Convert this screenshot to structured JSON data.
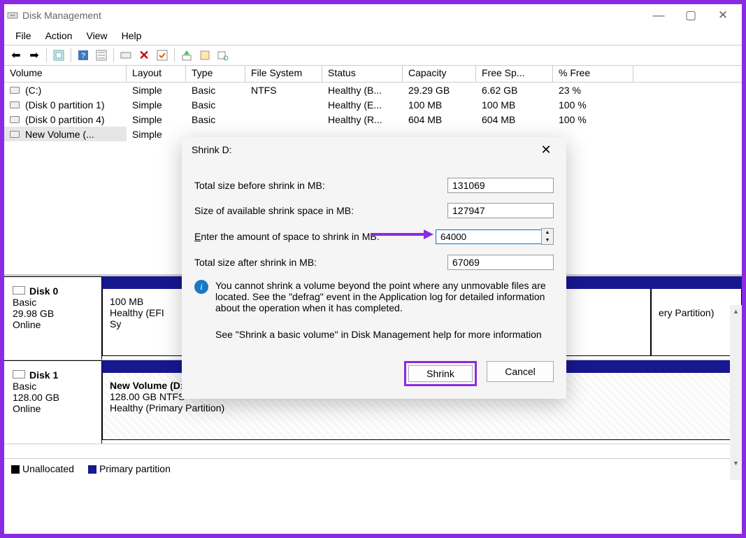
{
  "title": "Disk Management",
  "menu": {
    "file": "File",
    "action": "Action",
    "view": "View",
    "help": "Help"
  },
  "table": {
    "headers": {
      "vol": "Volume",
      "layout": "Layout",
      "type": "Type",
      "fs": "File System",
      "status": "Status",
      "cap": "Capacity",
      "free": "Free Sp...",
      "pct": "% Free"
    },
    "rows": [
      {
        "vol": "(C:)",
        "layout": "Simple",
        "type": "Basic",
        "fs": "NTFS",
        "status": "Healthy (B...",
        "cap": "29.29 GB",
        "free": "6.62 GB",
        "pct": "23 %"
      },
      {
        "vol": "(Disk 0 partition 1)",
        "layout": "Simple",
        "type": "Basic",
        "fs": "",
        "status": "Healthy (E...",
        "cap": "100 MB",
        "free": "100 MB",
        "pct": "100 %"
      },
      {
        "vol": "(Disk 0 partition 4)",
        "layout": "Simple",
        "type": "Basic",
        "fs": "",
        "status": "Healthy (R...",
        "cap": "604 MB",
        "free": "604 MB",
        "pct": "100 %"
      },
      {
        "vol": "New Volume (...",
        "layout": "Simple",
        "type": "",
        "fs": "",
        "status": "",
        "cap": "",
        "free": "",
        "pct": ""
      }
    ]
  },
  "disks": [
    {
      "name": "Disk 0",
      "type": "Basic",
      "size": "29.98 GB",
      "state": "Online",
      "parts": [
        {
          "title": "",
          "line1": "100 MB",
          "line2": "Healthy (EFI Sy"
        },
        {
          "title": "",
          "line1": "",
          "line2": ""
        },
        {
          "title": "",
          "line1": "",
          "line2": "ery Partition)"
        }
      ]
    },
    {
      "name": "Disk 1",
      "type": "Basic",
      "size": "128.00 GB",
      "state": "Online",
      "parts": [
        {
          "title": "New Volume  (D:)",
          "line1": "128.00 GB NTFS",
          "line2": "Healthy (Primary Partition)"
        }
      ]
    }
  ],
  "legend": {
    "unalloc": "Unallocated",
    "primary": "Primary partition"
  },
  "dialog": {
    "title": "Shrink D:",
    "l1": "Total size before shrink in MB:",
    "v1": "131069",
    "l2": "Size of available shrink space in MB:",
    "v2": "127947",
    "l3": "Enter the amount of space to shrink in MB:",
    "v3": "64000",
    "l4": "Total size after shrink in MB:",
    "v4": "67069",
    "info1": "You cannot shrink a volume beyond the point where any unmovable files are located. See the \"defrag\" event in the Application log for detailed information about the operation when it has completed.",
    "info2": "See \"Shrink a basic volume\" in Disk Management help for more information",
    "btn_shrink": "Shrink",
    "btn_cancel": "Cancel"
  }
}
